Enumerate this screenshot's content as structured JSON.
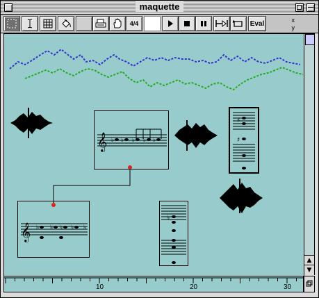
{
  "window": {
    "title": "maquette"
  },
  "toolbar": {
    "tools": [
      {
        "name": "select-tool",
        "label": ""
      },
      {
        "name": "text-cursor-tool",
        "label": ""
      },
      {
        "name": "grid-tool",
        "label": ""
      },
      {
        "name": "paint-bucket-tool",
        "label": ""
      },
      {
        "name": "print-tool",
        "label": ""
      },
      {
        "name": "hand-tool",
        "label": ""
      },
      {
        "name": "time-signature-tool",
        "label": "4/4"
      }
    ],
    "transport": {
      "play": "play",
      "stop": "stop",
      "pause": "pause",
      "step": "step",
      "loop": "loop",
      "eval_label": "Eval"
    },
    "coords": {
      "x_label": "x",
      "y_label": "y"
    }
  },
  "ruler": {
    "ticks_labeled": [
      "10",
      "20",
      "30"
    ]
  },
  "colors": {
    "canvas": "#98cccc",
    "blue_curve": "#3333cc",
    "green_curve": "#22aa22",
    "connection_dot": "#dd2222"
  }
}
